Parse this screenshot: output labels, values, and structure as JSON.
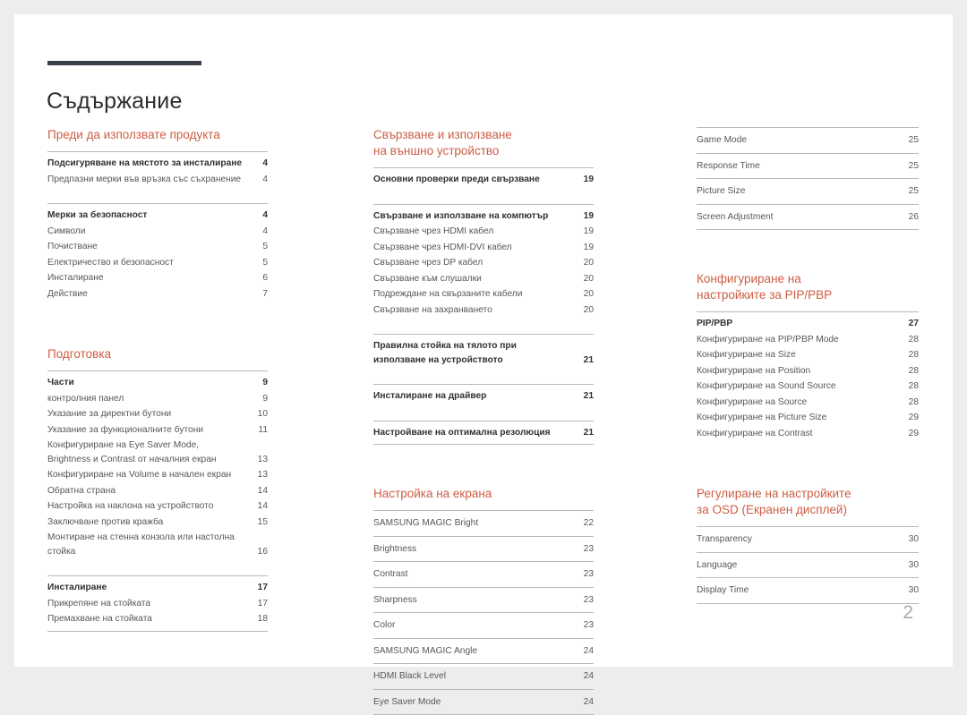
{
  "document": {
    "title": "Съдържание",
    "page_number": "2",
    "accent_color": "#cd5e44",
    "rule_color": "#b9b9b9",
    "title_bar_color": "#3b3f49"
  },
  "columns": [
    {
      "name": "column-1",
      "sections": [
        {
          "heading_line1": "Преди да използвате продукта",
          "heading_line2": "",
          "groups": [
            {
              "ruled_each": false,
              "rows": [
                {
                  "text": "Подсигуряване на мястото за инсталиране",
                  "page": "4",
                  "head": true
                },
                {
                  "text": "Предпазни мерки във връзка със съхранение",
                  "page": "4",
                  "head": false
                }
              ]
            },
            {
              "ruled_each": false,
              "rows": [
                {
                  "text": "Мерки за безопасност",
                  "page": "4",
                  "head": true
                },
                {
                  "text": "Символи",
                  "page": "4",
                  "head": false
                },
                {
                  "text": "Почистване",
                  "page": "5",
                  "head": false
                },
                {
                  "text": "Електричество и безопасност",
                  "page": "5",
                  "head": false
                },
                {
                  "text": "Инсталиране",
                  "page": "6",
                  "head": false
                },
                {
                  "text": "Действие",
                  "page": "7",
                  "head": false
                }
              ]
            }
          ]
        },
        {
          "heading_line1": "Подготовка",
          "heading_line2": "",
          "groups": [
            {
              "ruled_each": false,
              "rows": [
                {
                  "text": "Части",
                  "page": "9",
                  "head": true
                },
                {
                  "text": "контролния панел",
                  "page": "9",
                  "head": false
                },
                {
                  "text": "Указание за директни бутони",
                  "page": "10",
                  "head": false
                },
                {
                  "text": "Указание за функционалните бутони",
                  "page": "11",
                  "head": false
                },
                {
                  "text": "Конфигуриране на Eye Saver Mode, Brightness и Contrast от началния екран",
                  "page": "13",
                  "head": false,
                  "two_line": true
                },
                {
                  "text": "Конфигуриране на Volume в начален екран",
                  "page": "13",
                  "head": false
                },
                {
                  "text": "Обратна страна",
                  "page": "14",
                  "head": false
                },
                {
                  "text": "Настройка на наклона на устройството",
                  "page": "14",
                  "head": false
                },
                {
                  "text": "Заключване против кражба",
                  "page": "15",
                  "head": false
                },
                {
                  "text": "Монтиране на стенна конзола или настолна стойка",
                  "page": "16",
                  "head": false,
                  "two_line": true
                }
              ]
            },
            {
              "ruled_each": false,
              "last": true,
              "rows": [
                {
                  "text": "Инсталиране",
                  "page": "17",
                  "head": true
                },
                {
                  "text": "Прикрепяне на стойката",
                  "page": "17",
                  "head": false
                },
                {
                  "text": "Премахване на стойката",
                  "page": "18",
                  "head": false
                }
              ]
            }
          ]
        }
      ]
    },
    {
      "name": "column-2",
      "sections": [
        {
          "heading_line1": "Свързване и използване",
          "heading_line2": "на външно устройство",
          "groups": [
            {
              "ruled_each": false,
              "rows": [
                {
                  "text": "Основни проверки преди свързване",
                  "page": "19",
                  "head": true
                }
              ]
            },
            {
              "ruled_each": false,
              "rows": [
                {
                  "text": "Свързване и използване на компютър",
                  "page": "19",
                  "head": true
                },
                {
                  "text": "Свързване чрез HDMI кабел",
                  "page": "19",
                  "head": false
                },
                {
                  "text": "Свързване чрез HDMI-DVI кабел",
                  "page": "19",
                  "head": false
                },
                {
                  "text": "Свързване чрез DP кабел",
                  "page": "20",
                  "head": false
                },
                {
                  "text": "Свързване към слушалки",
                  "page": "20",
                  "head": false
                },
                {
                  "text": "Подреждане на свързаните кабели",
                  "page": "20",
                  "head": false
                },
                {
                  "text": "Свързване на захранването",
                  "page": "20",
                  "head": false
                }
              ]
            },
            {
              "ruled_each": false,
              "rows": [
                {
                  "text": "Правилна стойка на тялото при използване на устройството",
                  "page": "21",
                  "head": true,
                  "two_line": true
                }
              ]
            },
            {
              "ruled_each": false,
              "rows": [
                {
                  "text": "Инсталиране на драйвер",
                  "page": "21",
                  "head": true
                }
              ]
            },
            {
              "ruled_each": false,
              "last": true,
              "rows": [
                {
                  "text": "Настройване на оптимална резолюция",
                  "page": "21",
                  "head": true
                }
              ]
            }
          ]
        },
        {
          "heading_line1": "Настройка на екрана",
          "heading_line2": "",
          "groups": [
            {
              "ruled_each": true,
              "rows": [
                {
                  "text": "SAMSUNG MAGIC Bright",
                  "page": "22",
                  "head": false
                },
                {
                  "text": "Brightness",
                  "page": "23",
                  "head": false
                },
                {
                  "text": "Contrast",
                  "page": "23",
                  "head": false
                },
                {
                  "text": "Sharpness",
                  "page": "23",
                  "head": false
                },
                {
                  "text": "Color",
                  "page": "23",
                  "head": false
                },
                {
                  "text": "SAMSUNG MAGIC Angle",
                  "page": "24",
                  "head": false
                },
                {
                  "text": "HDMI Black Level",
                  "page": "24",
                  "head": false
                },
                {
                  "text": "Eye Saver Mode",
                  "page": "24",
                  "head": false
                }
              ]
            }
          ]
        }
      ]
    },
    {
      "name": "column-3",
      "sections": [
        {
          "heading_line1": "",
          "heading_line2": "",
          "groups": [
            {
              "ruled_each": true,
              "rows": [
                {
                  "text": "Game Mode",
                  "page": "25",
                  "head": false
                },
                {
                  "text": "Response Time",
                  "page": "25",
                  "head": false
                },
                {
                  "text": "Picture Size",
                  "page": "25",
                  "head": false
                },
                {
                  "text": "Screen Adjustment",
                  "page": "26",
                  "head": false
                }
              ]
            }
          ]
        },
        {
          "heading_line1": "Конфигуриране на",
          "heading_line2": "настройките за PIP/PBP",
          "groups": [
            {
              "ruled_each": false,
              "rows": [
                {
                  "text": "PIP/PBP",
                  "page": "27",
                  "head": true
                },
                {
                  "text": "Конфигуриране на PIP/PBP Mode",
                  "page": "28",
                  "head": false
                },
                {
                  "text": "Конфигуриране на Size",
                  "page": "28",
                  "head": false
                },
                {
                  "text": "Конфигуриране на Position",
                  "page": "28",
                  "head": false
                },
                {
                  "text": "Конфигуриране на Sound Source",
                  "page": "28",
                  "head": false
                },
                {
                  "text": "Конфигуриране на Source",
                  "page": "28",
                  "head": false
                },
                {
                  "text": "Конфигуриране на Picture Size",
                  "page": "29",
                  "head": false
                },
                {
                  "text": "Конфигуриране на Contrast",
                  "page": "29",
                  "head": false
                }
              ]
            }
          ]
        },
        {
          "heading_line1": "Регулиране на настройките",
          "heading_line2": "за OSD (Екранен дисплей)",
          "groups": [
            {
              "ruled_each": true,
              "rows": [
                {
                  "text": "Transparency",
                  "page": "30",
                  "head": false
                },
                {
                  "text": "Language",
                  "page": "30",
                  "head": false
                },
                {
                  "text": "Display Time",
                  "page": "30",
                  "head": false
                }
              ]
            }
          ]
        }
      ]
    }
  ]
}
